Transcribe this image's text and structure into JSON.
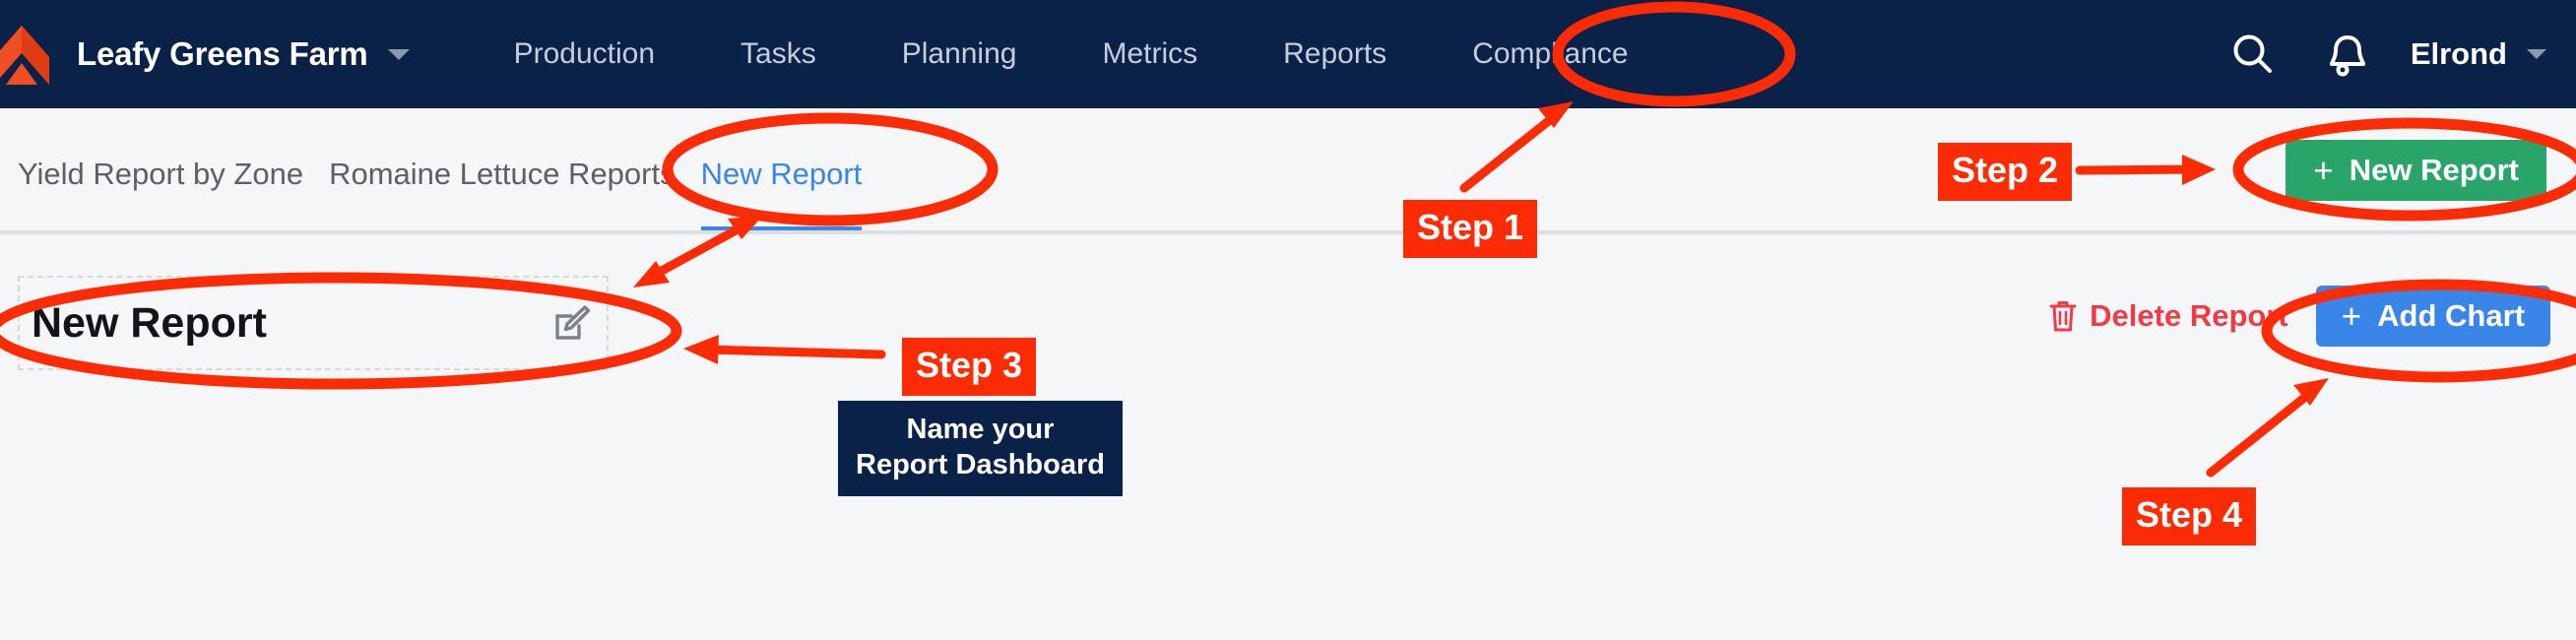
{
  "brand": {
    "name": "Leafy Greens Farm",
    "logo_icon": "chevron-logo-icon",
    "logo_color": "#f04e23",
    "dropdown_icon": "chevron-down-icon"
  },
  "nav": {
    "items": [
      {
        "label": "Production"
      },
      {
        "label": "Tasks"
      },
      {
        "label": "Planning"
      },
      {
        "label": "Metrics"
      },
      {
        "label": "Reports"
      },
      {
        "label": "Compliance"
      }
    ],
    "active": "Reports"
  },
  "topbar_right": {
    "search_icon": "search-icon",
    "notifications_icon": "bell-icon",
    "user_name": "Elrond",
    "user_dropdown_icon": "chevron-down-icon"
  },
  "tabs": {
    "items": [
      {
        "label": "Yield Report by Zone",
        "active": false
      },
      {
        "label": "Romaine Lettuce Reports",
        "active": false
      },
      {
        "label": "New Report",
        "active": true
      }
    ],
    "new_report_button": {
      "label": "New Report",
      "plus": "+",
      "color": "#2aa569"
    }
  },
  "content": {
    "title": "New Report",
    "edit_icon": "edit-pencil-icon",
    "delete_report": {
      "label": "Delete Report",
      "icon": "trash-icon",
      "color": "#ef3b45"
    },
    "add_chart_button": {
      "label": "Add Chart",
      "plus": "+",
      "color": "#3a86e8"
    }
  },
  "annotations": {
    "accent_color": "#fb2b06",
    "steps": [
      {
        "label": "Step 1"
      },
      {
        "label": "Step 2"
      },
      {
        "label": "Step 3"
      },
      {
        "label": "Step 4"
      }
    ],
    "tooltip": "Name your\nReport Dashboard"
  },
  "colors": {
    "header_navy": "#0a2148",
    "page_background": "#f5f6f8",
    "active_tab_blue": "#3a86e8",
    "annotation_red": "#fb2b06"
  }
}
